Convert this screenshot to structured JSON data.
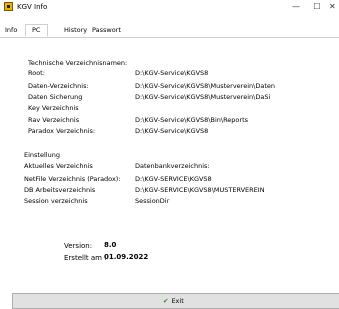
{
  "window": {
    "title": "KGV Info",
    "minimize": "—",
    "maximize": "☐",
    "close": "✕"
  },
  "tabs": [
    {
      "label": "Info",
      "active": false
    },
    {
      "label": "PC",
      "active": true
    },
    {
      "label": "History",
      "active": false
    },
    {
      "label": "Passwort",
      "active": false
    }
  ],
  "pc": {
    "section_title": "Technische Verzeichnisnamen:",
    "rows": [
      {
        "label": "Root:",
        "value": "D:\\KGV-Service\\KGVS8"
      },
      {
        "label": "Daten-Verzeichnis:",
        "value": "D:\\KGV-Service\\KGVS8\\Musterverein\\Daten"
      },
      {
        "label": "Daten Sicherung",
        "value": "D:\\KGV-Service\\KGVS8\\Musterverein\\DaSi"
      },
      {
        "label": "Key Verzeichnis",
        "value": ""
      },
      {
        "label": "Rav Verzeichnis",
        "value": "D:\\KGV-Service\\KGVS8\\Bin\\Reports"
      },
      {
        "label": "Paradox Verzeichnis:",
        "value": "D:\\KGV-Service\\KGVS8"
      }
    ],
    "settings_title": "Einstellung",
    "settings_rows": [
      {
        "label": "Aktuelles Verzeichnis",
        "value": "Datenbankverzeichnis:"
      },
      {
        "label": "NetFile Verzeichnis (Paradox):",
        "value": "D:\\KGV-SERVICE\\KGVS8"
      },
      {
        "label": "DB Arbeitsverzeichnis",
        "value": "D:\\KGV-SERVICE\\KGVS8\\MUSTERVEREIN"
      },
      {
        "label": "Session verzeichnis",
        "value": "SessionDir"
      }
    ],
    "version_label": "Version:",
    "version_value": "8.0",
    "created_label": "Erstellt am :",
    "created_value": "01.09.2022"
  },
  "footer": {
    "exit_label": "Exit",
    "exit_icon": "checkmark-icon"
  }
}
